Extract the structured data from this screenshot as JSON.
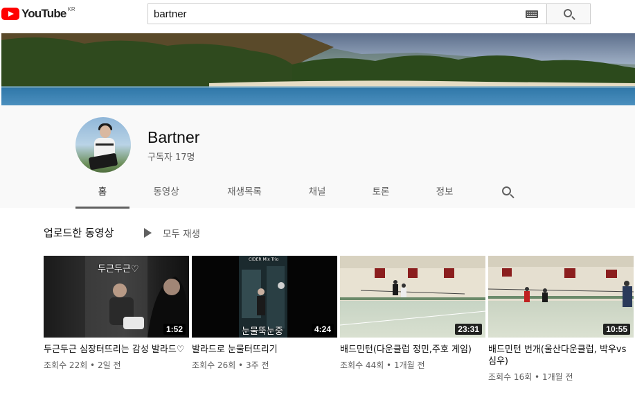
{
  "header": {
    "logo_text": "YouTube",
    "logo_region": "KR",
    "search_value": "bartner",
    "keyboard_icon": "keyboard-icon",
    "search_icon": "search-icon"
  },
  "channel": {
    "name": "Bartner",
    "subscribers": "구독자 17명"
  },
  "tabs": [
    {
      "label": "홈",
      "active": true
    },
    {
      "label": "동영상",
      "active": false
    },
    {
      "label": "재생목록",
      "active": false
    },
    {
      "label": "채널",
      "active": false
    },
    {
      "label": "토론",
      "active": false
    },
    {
      "label": "정보",
      "active": false
    }
  ],
  "section": {
    "title": "업로드한 동영상",
    "play_all": "모두 재생"
  },
  "videos": [
    {
      "title": "두근두근 심장터뜨리는 감성 발라드♡",
      "meta": "조회수 22회 • 2일 전",
      "duration": "1:52",
      "thumb_caption": "두근두근♡"
    },
    {
      "title": "발라드로 눈물터뜨리기",
      "meta": "조회수 26회 • 3주 전",
      "duration": "4:24",
      "thumb_caption": "눈물뚝눈중",
      "thumb_sign": "CIDER Mix Trio"
    },
    {
      "title": "배드민턴(다운클럽 정민,주호 게임)",
      "meta": "조회수 44회 • 1개월 전",
      "duration": "23:31"
    },
    {
      "title": "배드민턴 번개(울산다운클럽, 박우vs심우)",
      "meta": "조회수 16회 • 1개월 전",
      "duration": "10:55"
    }
  ],
  "colors": {
    "brand_red": "#ff0000",
    "header_bg": "#f9f9f9",
    "secondary_text": "#606060"
  }
}
